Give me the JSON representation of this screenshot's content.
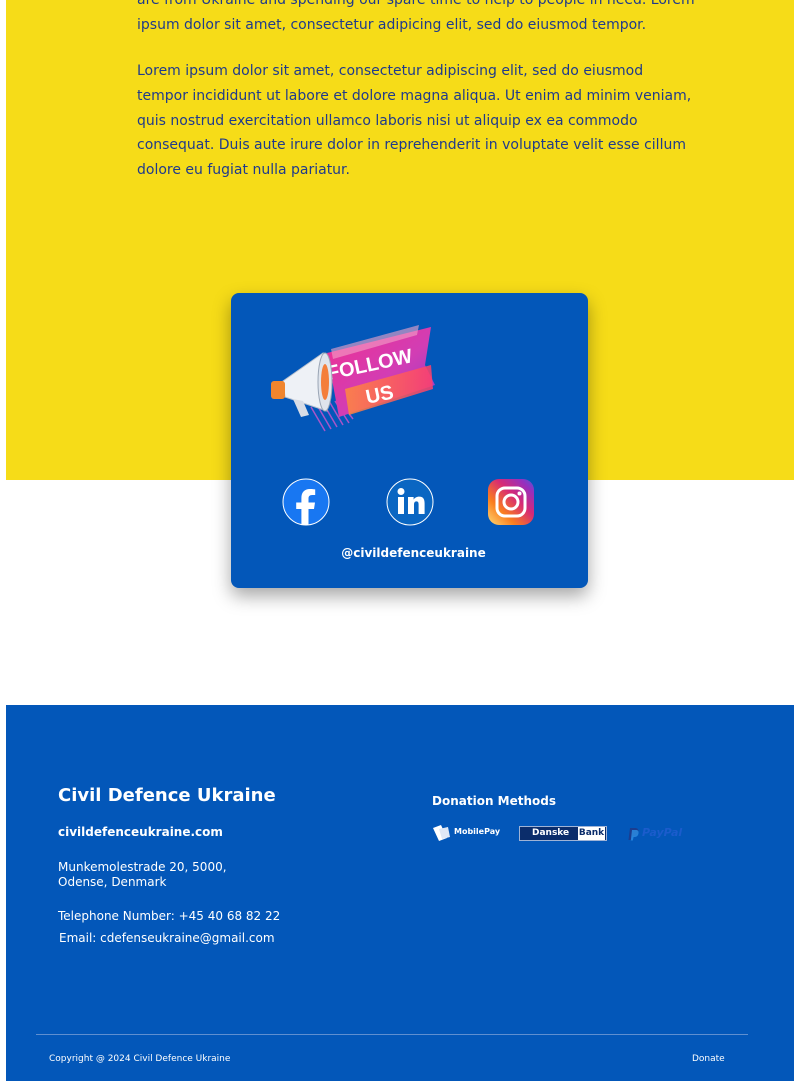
{
  "content": {
    "paragraph_1": "are from Ukraine and spending our spare time to help to people in need. Lorem ipsum dolor sit amet, consectetur adipicing elit, sed do eiusmod tempor.",
    "paragraph_2": "Lorem ipsum dolor sit amet, consectetur adipiscing elit, sed do eiusmod tempor incididunt ut labore et dolore magna aliqua. Ut enim ad minim veniam, quis nostrud exercitation ullamco laboris nisi ut aliquip ex ea commodo consequat. Duis aute irure dolor in reprehenderit in voluptate velit esse cillum dolore eu fugiat nulla pariatur."
  },
  "follow_card": {
    "banner_line_1": "FOLLOW",
    "banner_line_2": "US",
    "social_icons": [
      "facebook-icon",
      "linkedin-icon",
      "instagram-icon"
    ],
    "handle": "@civildefenceukraine"
  },
  "footer": {
    "brand": "Civil Defence Ukraine",
    "website": "civildefenceukraine.com",
    "address_line_1": "Munkemolestrade 20, 5000,",
    "address_line_2": "Odense, Denmark",
    "telephone": "Telephone Number: +45 40 68 82 22",
    "email": "Email: cdefenseukraine@gmail.com",
    "donation_title": "Donation Methods",
    "donation_methods": {
      "mobilepay": "MobilePay",
      "danske_1": "Danske",
      "danske_2": "Bank",
      "paypal": "PayPal"
    },
    "copyright": "Copyright @ 2024 Civil Defence Ukraine",
    "donate_link": "Donate"
  },
  "colors": {
    "yellow": "#f6dc18",
    "blue": "#0357b9",
    "text_blue": "#1f3a8c"
  }
}
